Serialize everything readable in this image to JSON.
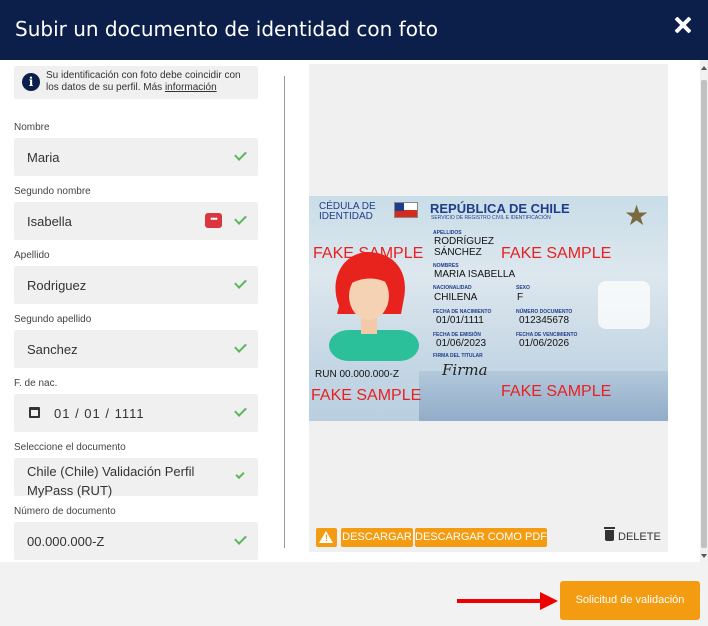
{
  "header": {
    "title": "Subir un documento de identidad con foto"
  },
  "info": {
    "text": "Su identificación con foto debe coincidir con los datos de su perfil. Más ",
    "link": "información"
  },
  "fields": {
    "nombre": {
      "label": "Nombre",
      "value": "Maria"
    },
    "segundo_nombre": {
      "label": "Segundo nombre",
      "value": "Isabella"
    },
    "apellido": {
      "label": "Apellido",
      "value": "Rodriguez"
    },
    "segundo_apellido": {
      "label": "Segundo apellido",
      "value": "Sanchez"
    },
    "fecha_nac": {
      "label": "F. de nac.",
      "value": "01 / 01 / 1111"
    },
    "documento": {
      "label": "Seleccione el documento",
      "value": "Chile (Chile) Validación Perfil MyPass (RUT)"
    },
    "numero": {
      "label": "Número de documento",
      "value": "00.000.000-Z"
    }
  },
  "id_card": {
    "cedula": "CÉDULA DE IDENTIDAD",
    "republica": "REPÚBLICA DE CHILE",
    "servicio": "SERVICIO DE REGISTRO CIVIL E IDENTIFICACIÓN",
    "fake": "FAKE SAMPLE",
    "apellidos_label": "APELLIDOS",
    "apellidos": "RODRÍGUEZ SÁNCHEZ",
    "nombres_label": "NOMBRES",
    "nombres": "MARIA ISABELLA",
    "nacionalidad_label": "NACIONALIDAD",
    "nacionalidad": "CHILENA",
    "sexo_label": "SEXO",
    "sexo": "F",
    "nacimiento_label": "FECHA DE NACIMIENTO",
    "nacimiento": "01/01/1111",
    "numdoc_label": "NÚMERO DOCUMENTO",
    "numdoc": "012345678",
    "emision_label": "FECHA DE EMISIÓN",
    "emision": "01/06/2023",
    "vencimiento_label": "FECHA DE VENCIMIENTO",
    "vencimiento": "01/06/2026",
    "firma_label": "FIRMA DEL TITULAR",
    "firma": "Firma",
    "run": "RUN 00.000.000-Z"
  },
  "actions": {
    "descargar": "DESCARGAR",
    "descargar_pdf": "DESCARGAR COMO PDF",
    "delete": "DELETE"
  },
  "footer": {
    "submit": "Solicitud de validación"
  },
  "colors": {
    "header_bg": "#0c1f4b",
    "accent": "#f39c12",
    "check": "#5cb85c",
    "fake": "#e82020"
  }
}
